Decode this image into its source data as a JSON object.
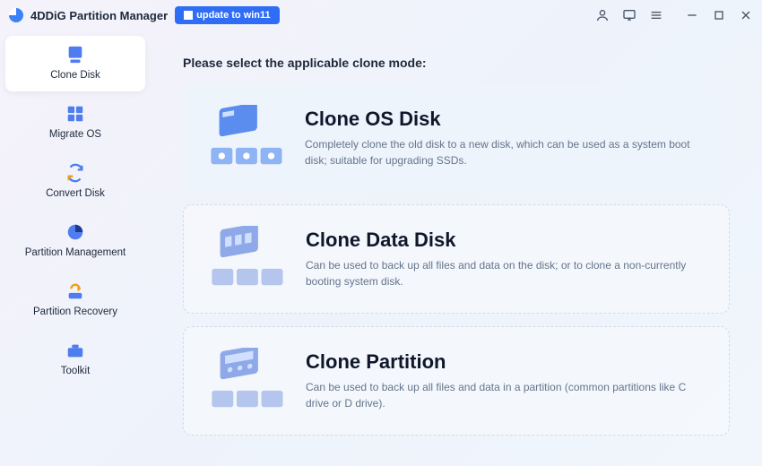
{
  "app": {
    "title": "4DDiG Partition Manager",
    "update_button": "update to win11"
  },
  "sidebar": {
    "items": [
      {
        "label": "Clone Disk",
        "icon": "clone-disk-icon",
        "active": true
      },
      {
        "label": "Migrate OS",
        "icon": "migrate-os-icon",
        "active": false
      },
      {
        "label": "Convert Disk",
        "icon": "convert-disk-icon",
        "active": false
      },
      {
        "label": "Partition Management",
        "icon": "partition-management-icon",
        "active": false
      },
      {
        "label": "Partition Recovery",
        "icon": "partition-recovery-icon",
        "active": false
      },
      {
        "label": "Toolkit",
        "icon": "toolkit-icon",
        "active": false
      }
    ]
  },
  "main": {
    "heading": "Please select the applicable clone mode:",
    "cards": [
      {
        "title": "Clone OS Disk",
        "description": "Completely clone the old disk to a new disk, which can be used as a system boot disk; suitable for upgrading SSDs.",
        "highlight": true
      },
      {
        "title": "Clone Data Disk",
        "description": "Can be used to back up all files and data on the disk; or to clone a non-currently booting system disk.",
        "highlight": false
      },
      {
        "title": "Clone Partition",
        "description": "Can be used to back up all files and data in a partition (common partitions like C drive or D drive).",
        "highlight": false
      }
    ]
  },
  "colors": {
    "accent": "#2f6df6"
  }
}
